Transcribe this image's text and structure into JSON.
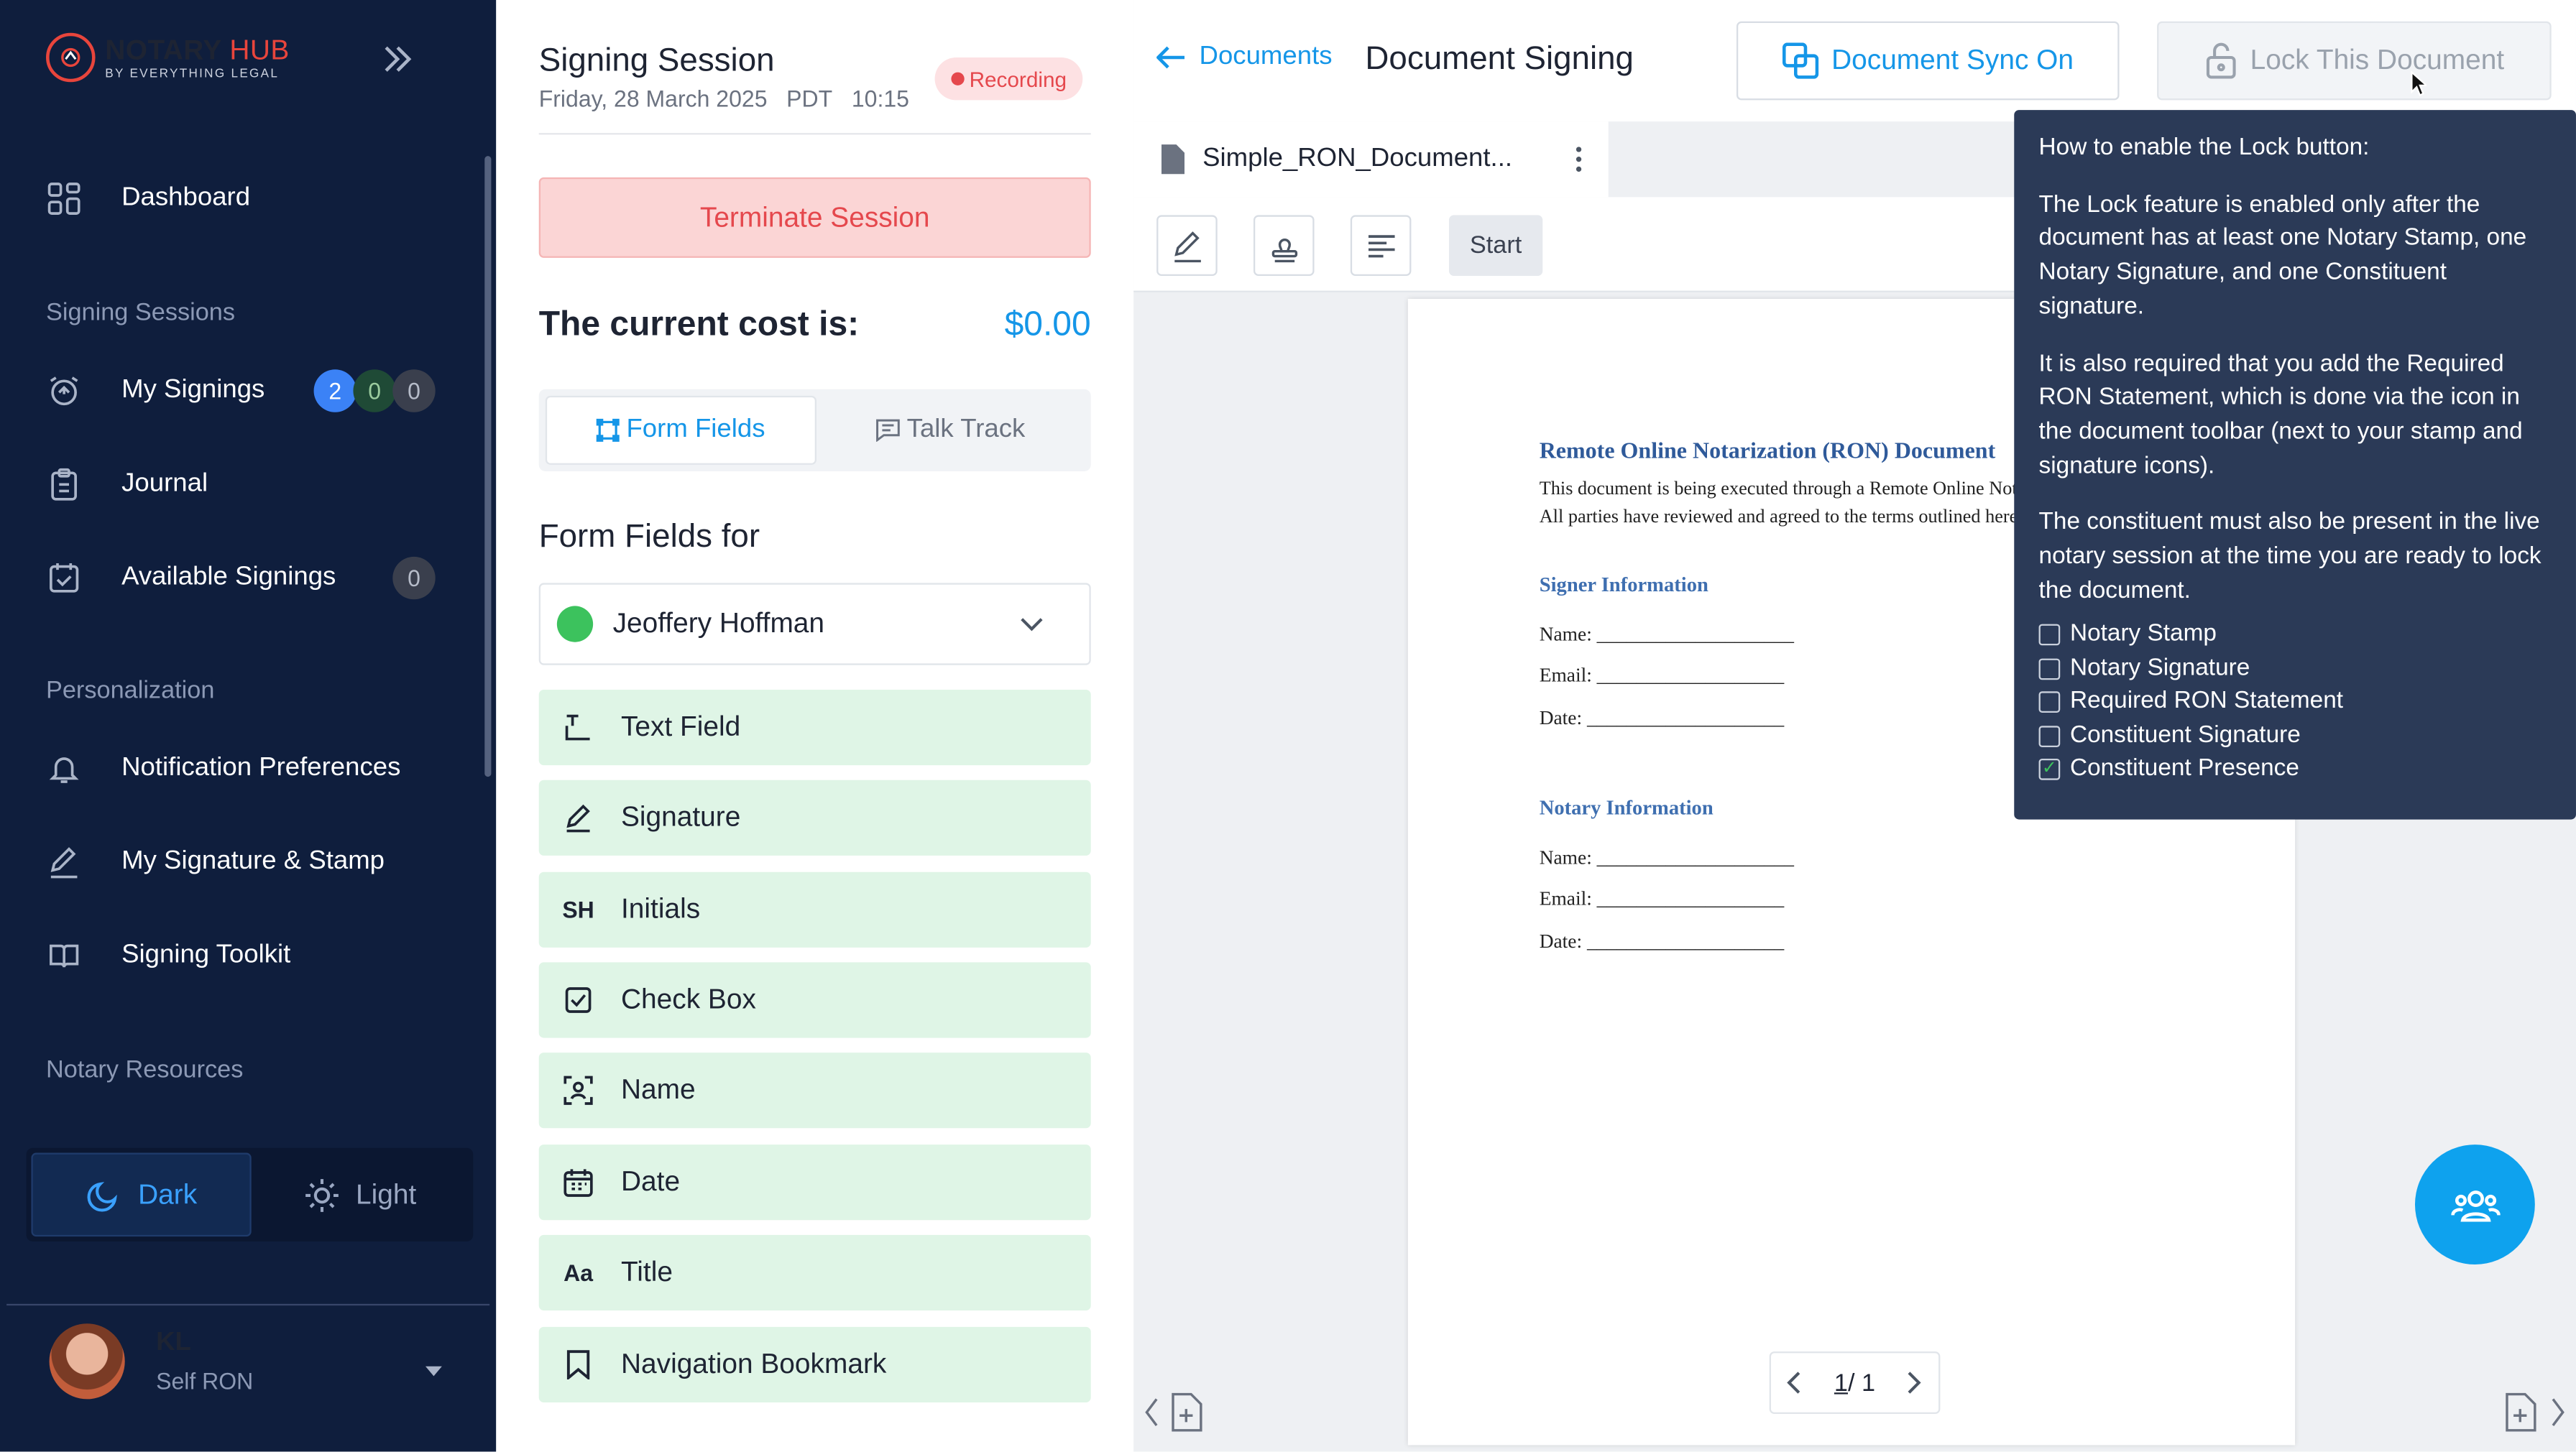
{
  "sidebar": {
    "brand": {
      "name_part1": "NOTARY",
      "name_part2": "HUB",
      "subtitle": "BY EVERYTHING LEGAL"
    },
    "nav": {
      "dashboard": "Dashboard",
      "signing_sessions_header": "Signing Sessions",
      "my_signings": "My Signings",
      "my_signings_badges": [
        "2",
        "0",
        "0"
      ],
      "journal": "Journal",
      "available_signings": "Available Signings",
      "available_signings_badge": "0",
      "personalization_header": "Personalization",
      "notification_preferences": "Notification Preferences",
      "my_signature_stamp": "My Signature & Stamp",
      "signing_toolkit": "Signing Toolkit",
      "notary_resources_header": "Notary Resources"
    },
    "theme": {
      "dark": "Dark",
      "light": "Light",
      "selected": "Dark"
    },
    "user": {
      "initials": "KL",
      "role": "Self RON"
    }
  },
  "session": {
    "title": "Signing Session",
    "date": "Friday, 28 March 2025",
    "timezone": "PDT",
    "time": "10:15",
    "recording": "Recording",
    "terminate": "Terminate Session",
    "cost_label": "The current cost is:",
    "cost_value": "$0.00",
    "tabs": {
      "form_fields": "Form Fields",
      "talk_track": "Talk Track",
      "active": "Form Fields"
    },
    "form_fields_header": "Form Fields for",
    "signer_name": "Jeoffery Hoffman",
    "fields": [
      "Text Field",
      "Signature",
      "Initials",
      "Check Box",
      "Name",
      "Date",
      "Title",
      "Navigation Bookmark"
    ]
  },
  "doc": {
    "back_label": "Documents",
    "title": "Document Signing",
    "sync_button": "Document Sync On",
    "lock_button": "Lock This Document",
    "file_name": "Simple_RON_Document...",
    "start_button": "Start",
    "page_current": "1",
    "page_total": "/ 1",
    "content": {
      "heading": "Remote Online Notarization (RON) Document",
      "intro": "This document is being executed through a Remote Online Notarization (RON) session. All parties have reviewed and agreed to the terms outlined herein.",
      "signer_header": "Signer Information",
      "notary_header": "Notary Information",
      "name_line": "Name: ____________________",
      "email_line": "Email: ___________________",
      "date_line": "Date: ____________________"
    }
  },
  "tooltip": {
    "title": "How to enable the Lock button:",
    "p1": "The Lock feature is enabled only after the document has at least one Notary Stamp, one Notary Signature, and one Constituent signature.",
    "p2": "It is also required that you add the Required RON Statement, which is done via the icon in the document toolbar (next to your stamp and signature icons).",
    "p3": "The constituent must also be present in the live notary session at the time you are ready to lock the document.",
    "checklist": [
      {
        "label": "Notary Stamp",
        "checked": false
      },
      {
        "label": "Notary Signature",
        "checked": false
      },
      {
        "label": "Required RON Statement",
        "checked": false
      },
      {
        "label": "Constituent Signature",
        "checked": false
      },
      {
        "label": "Constituent Presence",
        "checked": true
      }
    ]
  },
  "colors": {
    "sidebar_bg": "#0f1e3d",
    "accent": "#1596e8",
    "danger": "#e5484d",
    "field_bg": "#dff5e6",
    "tooltip_bg": "#2b3a57"
  }
}
